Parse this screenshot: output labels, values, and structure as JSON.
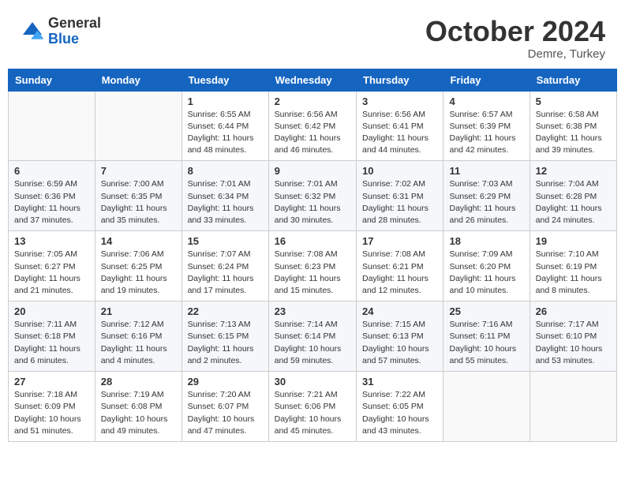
{
  "logo": {
    "general": "General",
    "blue": "Blue"
  },
  "header": {
    "month": "October 2024",
    "location": "Demre, Turkey"
  },
  "weekdays": [
    "Sunday",
    "Monday",
    "Tuesday",
    "Wednesday",
    "Thursday",
    "Friday",
    "Saturday"
  ],
  "weeks": [
    [
      {
        "day": "",
        "info": ""
      },
      {
        "day": "",
        "info": ""
      },
      {
        "day": "1",
        "info": "Sunrise: 6:55 AM\nSunset: 6:44 PM\nDaylight: 11 hours and 48 minutes."
      },
      {
        "day": "2",
        "info": "Sunrise: 6:56 AM\nSunset: 6:42 PM\nDaylight: 11 hours and 46 minutes."
      },
      {
        "day": "3",
        "info": "Sunrise: 6:56 AM\nSunset: 6:41 PM\nDaylight: 11 hours and 44 minutes."
      },
      {
        "day": "4",
        "info": "Sunrise: 6:57 AM\nSunset: 6:39 PM\nDaylight: 11 hours and 42 minutes."
      },
      {
        "day": "5",
        "info": "Sunrise: 6:58 AM\nSunset: 6:38 PM\nDaylight: 11 hours and 39 minutes."
      }
    ],
    [
      {
        "day": "6",
        "info": "Sunrise: 6:59 AM\nSunset: 6:36 PM\nDaylight: 11 hours and 37 minutes."
      },
      {
        "day": "7",
        "info": "Sunrise: 7:00 AM\nSunset: 6:35 PM\nDaylight: 11 hours and 35 minutes."
      },
      {
        "day": "8",
        "info": "Sunrise: 7:01 AM\nSunset: 6:34 PM\nDaylight: 11 hours and 33 minutes."
      },
      {
        "day": "9",
        "info": "Sunrise: 7:01 AM\nSunset: 6:32 PM\nDaylight: 11 hours and 30 minutes."
      },
      {
        "day": "10",
        "info": "Sunrise: 7:02 AM\nSunset: 6:31 PM\nDaylight: 11 hours and 28 minutes."
      },
      {
        "day": "11",
        "info": "Sunrise: 7:03 AM\nSunset: 6:29 PM\nDaylight: 11 hours and 26 minutes."
      },
      {
        "day": "12",
        "info": "Sunrise: 7:04 AM\nSunset: 6:28 PM\nDaylight: 11 hours and 24 minutes."
      }
    ],
    [
      {
        "day": "13",
        "info": "Sunrise: 7:05 AM\nSunset: 6:27 PM\nDaylight: 11 hours and 21 minutes."
      },
      {
        "day": "14",
        "info": "Sunrise: 7:06 AM\nSunset: 6:25 PM\nDaylight: 11 hours and 19 minutes."
      },
      {
        "day": "15",
        "info": "Sunrise: 7:07 AM\nSunset: 6:24 PM\nDaylight: 11 hours and 17 minutes."
      },
      {
        "day": "16",
        "info": "Sunrise: 7:08 AM\nSunset: 6:23 PM\nDaylight: 11 hours and 15 minutes."
      },
      {
        "day": "17",
        "info": "Sunrise: 7:08 AM\nSunset: 6:21 PM\nDaylight: 11 hours and 12 minutes."
      },
      {
        "day": "18",
        "info": "Sunrise: 7:09 AM\nSunset: 6:20 PM\nDaylight: 11 hours and 10 minutes."
      },
      {
        "day": "19",
        "info": "Sunrise: 7:10 AM\nSunset: 6:19 PM\nDaylight: 11 hours and 8 minutes."
      }
    ],
    [
      {
        "day": "20",
        "info": "Sunrise: 7:11 AM\nSunset: 6:18 PM\nDaylight: 11 hours and 6 minutes."
      },
      {
        "day": "21",
        "info": "Sunrise: 7:12 AM\nSunset: 6:16 PM\nDaylight: 11 hours and 4 minutes."
      },
      {
        "day": "22",
        "info": "Sunrise: 7:13 AM\nSunset: 6:15 PM\nDaylight: 11 hours and 2 minutes."
      },
      {
        "day": "23",
        "info": "Sunrise: 7:14 AM\nSunset: 6:14 PM\nDaylight: 10 hours and 59 minutes."
      },
      {
        "day": "24",
        "info": "Sunrise: 7:15 AM\nSunset: 6:13 PM\nDaylight: 10 hours and 57 minutes."
      },
      {
        "day": "25",
        "info": "Sunrise: 7:16 AM\nSunset: 6:11 PM\nDaylight: 10 hours and 55 minutes."
      },
      {
        "day": "26",
        "info": "Sunrise: 7:17 AM\nSunset: 6:10 PM\nDaylight: 10 hours and 53 minutes."
      }
    ],
    [
      {
        "day": "27",
        "info": "Sunrise: 7:18 AM\nSunset: 6:09 PM\nDaylight: 10 hours and 51 minutes."
      },
      {
        "day": "28",
        "info": "Sunrise: 7:19 AM\nSunset: 6:08 PM\nDaylight: 10 hours and 49 minutes."
      },
      {
        "day": "29",
        "info": "Sunrise: 7:20 AM\nSunset: 6:07 PM\nDaylight: 10 hours and 47 minutes."
      },
      {
        "day": "30",
        "info": "Sunrise: 7:21 AM\nSunset: 6:06 PM\nDaylight: 10 hours and 45 minutes."
      },
      {
        "day": "31",
        "info": "Sunrise: 7:22 AM\nSunset: 6:05 PM\nDaylight: 10 hours and 43 minutes."
      },
      {
        "day": "",
        "info": ""
      },
      {
        "day": "",
        "info": ""
      }
    ]
  ]
}
